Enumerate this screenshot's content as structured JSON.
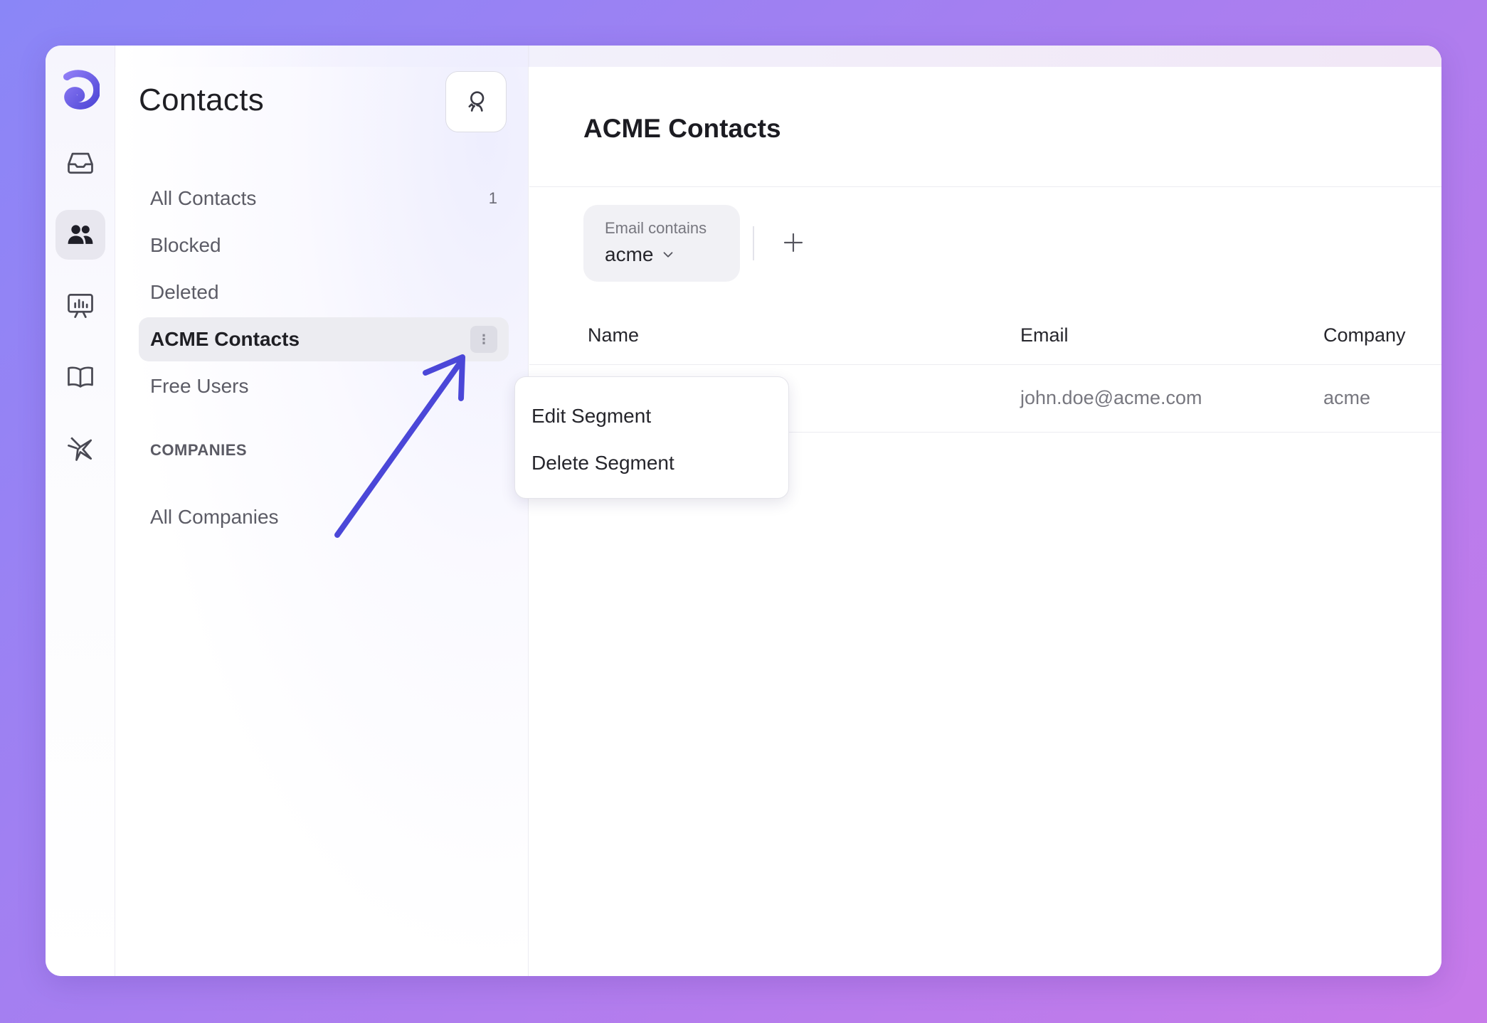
{
  "colors": {
    "brand": "#5e57e8",
    "annotation_arrow": "#4b47d8",
    "active_item_bg": "#ececf1"
  },
  "rail": {
    "items": [
      {
        "icon": "logo-icon"
      },
      {
        "icon": "inbox-icon"
      },
      {
        "icon": "contacts-icon",
        "active": true
      },
      {
        "icon": "reports-icon"
      },
      {
        "icon": "help-center-icon"
      },
      {
        "icon": "campaigns-icon"
      }
    ]
  },
  "sidebar": {
    "title": "Contacts",
    "refresh_icon": "refresh-user-icon",
    "segments": [
      {
        "label": "All Contacts",
        "count": "1"
      },
      {
        "label": "Blocked"
      },
      {
        "label": "Deleted"
      },
      {
        "label": "ACME Contacts",
        "active": true,
        "menu_icon": "more-vertical-icon"
      },
      {
        "label": "Free Users"
      }
    ],
    "companies_section": {
      "label": "COMPANIES",
      "items": [
        {
          "label": "All Companies"
        }
      ]
    }
  },
  "segment_menu": {
    "items": [
      {
        "label": "Edit Segment"
      },
      {
        "label": "Delete Segment"
      }
    ]
  },
  "main": {
    "title": "ACME Contacts",
    "filter": {
      "label": "Email contains",
      "value": "acme"
    },
    "table": {
      "columns": [
        "Name",
        "Email",
        "Company"
      ],
      "rows": [
        {
          "name": "",
          "email": "john.doe@acme.com",
          "company": "acme"
        }
      ]
    }
  }
}
